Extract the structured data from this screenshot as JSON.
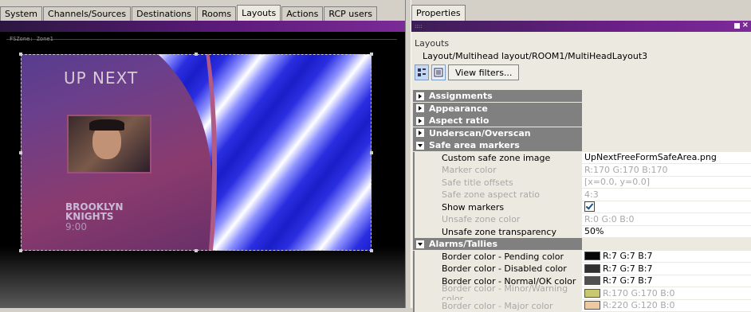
{
  "left_tabs": [
    "System",
    "Channels/Sources",
    "Destinations",
    "Rooms",
    "Layouts",
    "Actions",
    "RCP users"
  ],
  "active_tab": "Layouts",
  "zone_label": "FSZone: Zone1",
  "video": {
    "up_next": "UP NEXT",
    "show_line1": "BROOKLYN",
    "show_line2": "KNIGHTS",
    "show_time": "9:00"
  },
  "properties": {
    "tab_label": "Properties",
    "section_title": "Layouts",
    "path": "Layout/Multihead layout/ROOM1/MultiHeadLayout3",
    "view_filters_label": "View filters...",
    "collapsed_categories": [
      "Assignments",
      "Appearance",
      "Aspect ratio",
      "Underscan/Overscan"
    ],
    "safe_area": {
      "title": "Safe area markers",
      "rows": [
        {
          "name": "Custom safe zone image",
          "value": "UpNextFreeFormSafeArea.png",
          "disabled": false
        },
        {
          "name": "Marker color",
          "value": "R:170 G:170 B:170",
          "disabled": true
        },
        {
          "name": "Safe title offsets",
          "value": "[x=0.0, y=0.0]",
          "disabled": true
        },
        {
          "name": "Safe zone aspect ratio",
          "value": "4:3",
          "disabled": true
        },
        {
          "name": "Show markers",
          "value": "",
          "checked": true,
          "disabled": false
        },
        {
          "name": "Unsafe zone color",
          "value": "R:0 G:0 B:0",
          "disabled": true
        },
        {
          "name": "Unsafe zone transparency",
          "value": "50%",
          "disabled": false
        }
      ]
    },
    "alarms": {
      "title": "Alarms/Tallies",
      "rows": [
        {
          "name": "Border color - Pending color",
          "value": "R:7 G:7 B:7",
          "swatch": "#070707",
          "disabled": false
        },
        {
          "name": "Border color - Disabled color",
          "value": "R:7 G:7 B:7",
          "swatch": "#303030",
          "disabled": false
        },
        {
          "name": "Border color - Normal/OK color",
          "value": "R:7 G:7 B:7",
          "swatch": "#505050",
          "disabled": false
        },
        {
          "name": "Border color - Minor/Warning color",
          "value": "R:170 G:170 B:0",
          "swatch": "#c8c870",
          "disabled": true
        },
        {
          "name": "Border color - Major color",
          "value": "R:220 G:120 B:0",
          "swatch": "#f0c8a0",
          "disabled": true
        }
      ]
    }
  }
}
